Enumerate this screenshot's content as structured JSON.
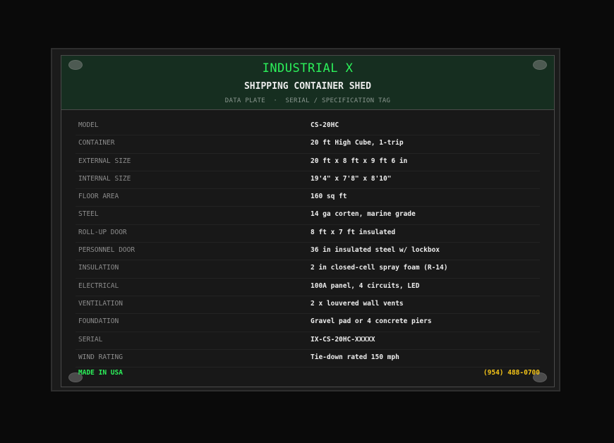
{
  "header": {
    "brand": "INDUSTRIAL X",
    "product": "SHIPPING CONTAINER SHED",
    "subtitle": "DATA PLATE  ·  SERIAL / SPECIFICATION TAG"
  },
  "specs": [
    {
      "label": "MODEL",
      "value": "CS-20HC"
    },
    {
      "label": "CONTAINER",
      "value": "20 ft High Cube, 1-trip"
    },
    {
      "label": "EXTERNAL SIZE",
      "value": "20 ft x 8 ft x 9 ft 6 in"
    },
    {
      "label": "INTERNAL SIZE",
      "value": "19'4\" x 7'8\" x 8'10\""
    },
    {
      "label": "FLOOR AREA",
      "value": "160 sq ft"
    },
    {
      "label": "STEEL",
      "value": "14 ga corten, marine grade"
    },
    {
      "label": "ROLL-UP DOOR",
      "value": "8 ft x 7 ft insulated"
    },
    {
      "label": "PERSONNEL DOOR",
      "value": "36 in insulated steel w/ lockbox"
    },
    {
      "label": "INSULATION",
      "value": "2 in closed-cell spray foam (R-14)"
    },
    {
      "label": "ELECTRICAL",
      "value": "100A panel, 4 circuits, LED"
    },
    {
      "label": "VENTILATION",
      "value": "2 x louvered wall vents"
    },
    {
      "label": "FOUNDATION",
      "value": "Gravel pad or 4 concrete piers"
    },
    {
      "label": "SERIAL",
      "value": "IX-CS-20HC-XXXXX"
    },
    {
      "label": "WIND RATING",
      "value": "Tie-down rated 150 mph"
    }
  ],
  "footer": {
    "origin": "MADE IN USA",
    "phone": "(954) 488-0700"
  },
  "colors": {
    "accent_green": "#2cf05a",
    "accent_yellow": "#f5c518",
    "header_bg": "#162e20",
    "plate_bg": "#181818"
  }
}
